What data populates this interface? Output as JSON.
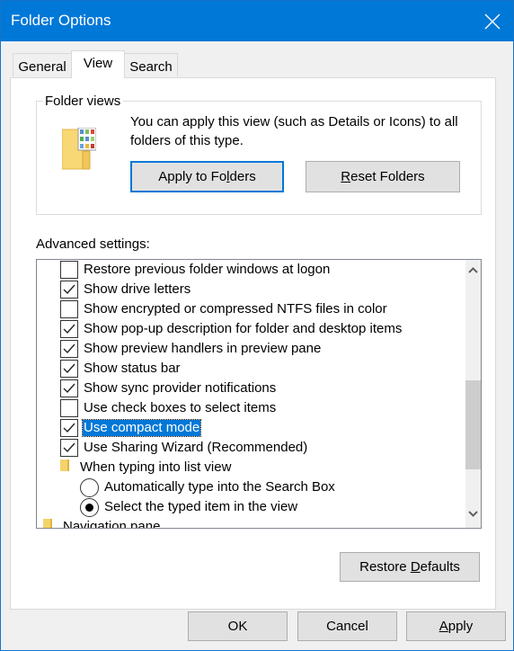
{
  "window": {
    "title": "Folder Options",
    "close_icon": "close-icon"
  },
  "tabs": [
    {
      "label": "General",
      "active": false
    },
    {
      "label": "View",
      "active": true
    },
    {
      "label": "Search",
      "active": false
    }
  ],
  "folder_views": {
    "legend": "Folder views",
    "icon": "folder-views-icon",
    "description": "You can apply this view (such as Details or Icons) to all folders of this type.",
    "apply_button": {
      "pre": "Apply to Fo",
      "accel": "l",
      "post": "ders"
    },
    "reset_button": {
      "pre": "",
      "accel": "R",
      "post": "eset Folders"
    }
  },
  "advanced": {
    "label": "Advanced settings:",
    "items": [
      {
        "type": "checkbox",
        "label": "Restore previous folder windows at logon",
        "checked": false,
        "indent": 1
      },
      {
        "type": "checkbox",
        "label": "Show drive letters",
        "checked": true,
        "indent": 1
      },
      {
        "type": "checkbox",
        "label": "Show encrypted or compressed NTFS files in color",
        "checked": false,
        "indent": 1
      },
      {
        "type": "checkbox",
        "label": "Show pop-up description for folder and desktop items",
        "checked": true,
        "indent": 1
      },
      {
        "type": "checkbox",
        "label": "Show preview handlers in preview pane",
        "checked": true,
        "indent": 1
      },
      {
        "type": "checkbox",
        "label": "Show status bar",
        "checked": true,
        "indent": 1
      },
      {
        "type": "checkbox",
        "label": "Show sync provider notifications",
        "checked": true,
        "indent": 1
      },
      {
        "type": "checkbox",
        "label": "Use check boxes to select items",
        "checked": false,
        "indent": 1
      },
      {
        "type": "checkbox",
        "label": "Use compact mode",
        "checked": true,
        "indent": 1,
        "selected": true
      },
      {
        "type": "checkbox",
        "label": "Use Sharing Wizard (Recommended)",
        "checked": true,
        "indent": 1
      },
      {
        "type": "folder",
        "label": "When typing into list view",
        "indent": 1
      },
      {
        "type": "radio",
        "label": "Automatically type into the Search Box",
        "checked": false,
        "indent": 2
      },
      {
        "type": "radio",
        "label": "Select the typed item in the view",
        "checked": true,
        "indent": 2
      },
      {
        "type": "folder",
        "label": "Navigation pane",
        "indent": 0
      }
    ],
    "scroll_up_icon": "chevron-up-icon",
    "scroll_down_icon": "chevron-down-icon"
  },
  "restore_defaults": {
    "pre": "Restore ",
    "accel": "D",
    "post": "efaults"
  },
  "footer": {
    "ok": "OK",
    "cancel": "Cancel",
    "apply": {
      "pre": "",
      "accel": "A",
      "post": "pply"
    }
  },
  "colors": {
    "accent": "#0078d7",
    "selection": "#0078d7"
  }
}
